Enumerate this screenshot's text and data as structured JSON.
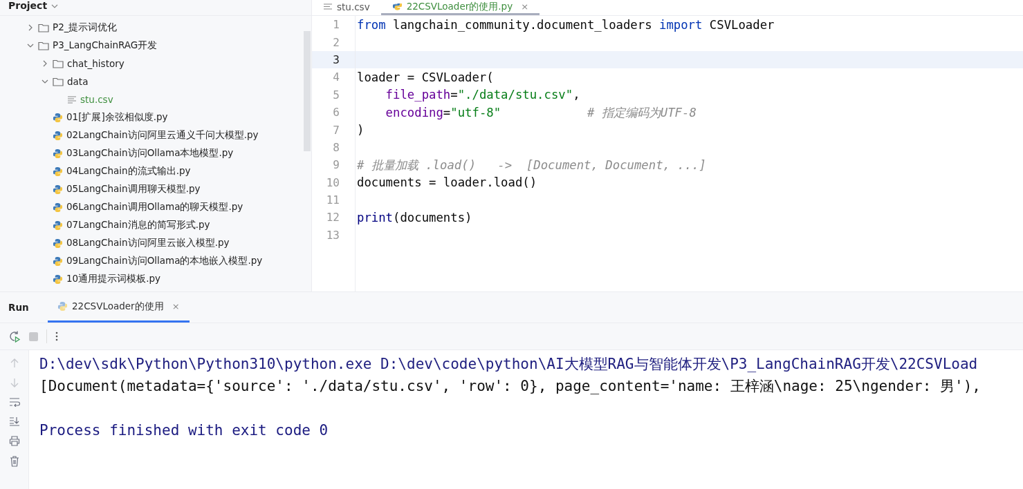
{
  "project": {
    "title": "Project",
    "tree": [
      {
        "label": "P2_提示词优化",
        "kind": "folder",
        "expanded": false
      },
      {
        "label": "P3_LangChainRAG开发",
        "kind": "folder",
        "expanded": true,
        "children": [
          {
            "label": "chat_history",
            "kind": "folder",
            "expanded": false
          },
          {
            "label": "data",
            "kind": "folder",
            "expanded": true,
            "children": [
              {
                "label": "stu.csv",
                "kind": "text"
              }
            ]
          },
          {
            "label": "01[扩展]余弦相似度.py",
            "kind": "python"
          },
          {
            "label": "02LangChain访问阿里云通义千问大模型.py",
            "kind": "python"
          },
          {
            "label": "03LangChain访问Ollama本地模型.py",
            "kind": "python"
          },
          {
            "label": "04LangChain的流式输出.py",
            "kind": "python"
          },
          {
            "label": "05LangChain调用聊天模型.py",
            "kind": "python"
          },
          {
            "label": "06LangChain调用Ollama的聊天模型.py",
            "kind": "python"
          },
          {
            "label": "07LangChain消息的简写形式.py",
            "kind": "python"
          },
          {
            "label": "08LangChain访问阿里云嵌入模型.py",
            "kind": "python"
          },
          {
            "label": "09LangChain访问Ollama的本地嵌入模型.py",
            "kind": "python"
          },
          {
            "label": "10通用提示词模板.py",
            "kind": "python"
          }
        ]
      }
    ]
  },
  "editor": {
    "tabs": [
      {
        "label": "stu.csv",
        "kind": "text",
        "selected": false
      },
      {
        "label": "22CSVLoader的使用.py",
        "kind": "python",
        "selected": true,
        "close": "×"
      }
    ],
    "lines": [
      {
        "number": "1",
        "current": false,
        "tokens": [
          {
            "text": "from",
            "kind": "keyword"
          },
          {
            "text": " langchain_community.document_loaders ",
            "kind": "plain"
          },
          {
            "text": "import",
            "kind": "keyword"
          },
          {
            "text": " CSVLoader",
            "kind": "plain"
          }
        ]
      },
      {
        "number": "2",
        "current": false
      },
      {
        "number": "3",
        "current": true
      },
      {
        "number": "4",
        "current": false,
        "tokens": [
          {
            "text": "loader = CSVLoader(",
            "kind": "plain"
          }
        ]
      },
      {
        "number": "5",
        "current": false,
        "tokens": [
          {
            "text": "    file_path",
            "kind": "param"
          },
          {
            "text": "=",
            "kind": "plain"
          },
          {
            "text": "\"./data/stu.csv\"",
            "kind": "string"
          },
          {
            "text": ",",
            "kind": "plain"
          }
        ]
      },
      {
        "number": "6",
        "current": false,
        "tokens": [
          {
            "text": "    encoding",
            "kind": "param"
          },
          {
            "text": "=",
            "kind": "plain"
          },
          {
            "text": "\"utf-8\"",
            "kind": "string"
          },
          {
            "text": "            # 指定编码为UTF-8",
            "kind": "comment"
          }
        ]
      },
      {
        "number": "7",
        "current": false,
        "tokens": [
          {
            "text": ")",
            "kind": "plain"
          }
        ]
      },
      {
        "number": "8",
        "current": false
      },
      {
        "number": "9",
        "current": false,
        "tokens": [
          {
            "text": "# 批量加载 .load()   ->  [Document, Document, ...]",
            "kind": "comment"
          }
        ]
      },
      {
        "number": "10",
        "current": false,
        "tokens": [
          {
            "text": "documents = loader.load()",
            "kind": "plain"
          }
        ]
      },
      {
        "number": "11",
        "current": false
      },
      {
        "number": "12",
        "current": false,
        "tokens": [
          {
            "text": "print",
            "kind": "builtin"
          },
          {
            "text": "(documents)",
            "kind": "plain"
          }
        ]
      },
      {
        "number": "13",
        "current": false
      }
    ]
  },
  "run": {
    "title": "Run",
    "tab": {
      "label": "22CSVLoader的使用",
      "close": "×",
      "selected": true
    },
    "output": [
      {
        "text": "D:\\dev\\sdk\\Python\\Python310\\python.exe D:\\dev\\code\\python\\AI大模型RAG与智能体开发\\P3_LangChainRAG开发\\22CSVLoad",
        "kind": "command"
      },
      {
        "text": "[Document(metadata={'source': './data/stu.csv', 'row': 0}, page_content='name: 王梓涵\\nage: 25\\ngender: 男'),",
        "kind": "stdout"
      },
      {
        "text": "Process finished with exit code 0",
        "kind": "exit"
      }
    ]
  }
}
